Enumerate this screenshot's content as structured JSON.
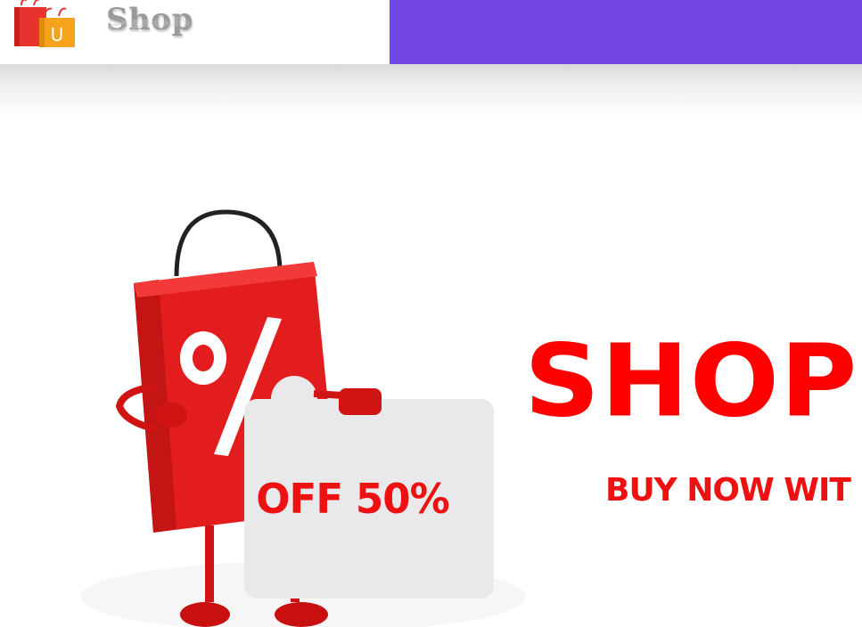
{
  "header": {
    "brand_name": "Shop",
    "logo_icon": "shopping-bags-icon",
    "logo_letter": "U",
    "band_color": "#7347e5"
  },
  "hero": {
    "headline": "SHOP",
    "subline": "BUY NOW WIT",
    "sign_text": "OFF 50%",
    "bag_symbol": "%",
    "accent_color": "#ff0000"
  }
}
